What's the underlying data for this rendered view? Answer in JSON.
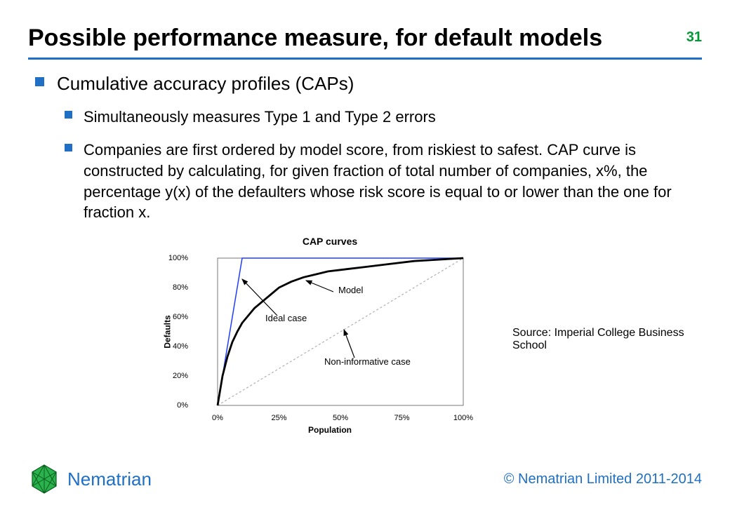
{
  "header": {
    "title": "Possible performance measure, for default models",
    "page_number": "31"
  },
  "bullets": {
    "level1": "Cumulative accuracy profiles (CAPs)",
    "level2": [
      "Simultaneously measures Type 1 and Type 2 errors",
      "Companies are first ordered by model score, from riskiest to safest. CAP curve is constructed by calculating, for given fraction of total number of companies, x%, the percentage y(x) of the defaulters whose risk score is equal to or lower than the one for fraction x."
    ]
  },
  "source": "Source: Imperial College Business School",
  "footer": {
    "brand": "Nematrian",
    "copyright": "© Nematrian Limited 2011-2014"
  },
  "chart_data": {
    "type": "line",
    "title": "CAP curves",
    "xlabel": "Population",
    "ylabel": "Defaults",
    "xlim": [
      0,
      100
    ],
    "ylim": [
      0,
      100
    ],
    "x_ticks": [
      "0%",
      "25%",
      "50%",
      "75%",
      "100%"
    ],
    "y_ticks": [
      "0%",
      "20%",
      "40%",
      "60%",
      "80%",
      "100%"
    ],
    "annotations": [
      "Model",
      "Ideal case",
      "Non-informative case"
    ],
    "series": [
      {
        "name": "Ideal case",
        "style": "blue-thin",
        "x": [
          0,
          10,
          100
        ],
        "y": [
          0,
          100,
          100
        ]
      },
      {
        "name": "Model",
        "style": "black-thick",
        "x": [
          0,
          2,
          4,
          6,
          8,
          10,
          15,
          20,
          25,
          30,
          35,
          40,
          45,
          50,
          55,
          60,
          70,
          80,
          90,
          100
        ],
        "y": [
          0,
          20,
          33,
          43,
          50,
          56,
          66,
          73,
          80,
          84,
          87,
          89,
          91,
          92,
          93,
          94,
          96,
          98,
          99,
          100
        ]
      },
      {
        "name": "Non-informative case",
        "style": "gray-dashed",
        "x": [
          0,
          100
        ],
        "y": [
          0,
          100
        ]
      }
    ]
  }
}
